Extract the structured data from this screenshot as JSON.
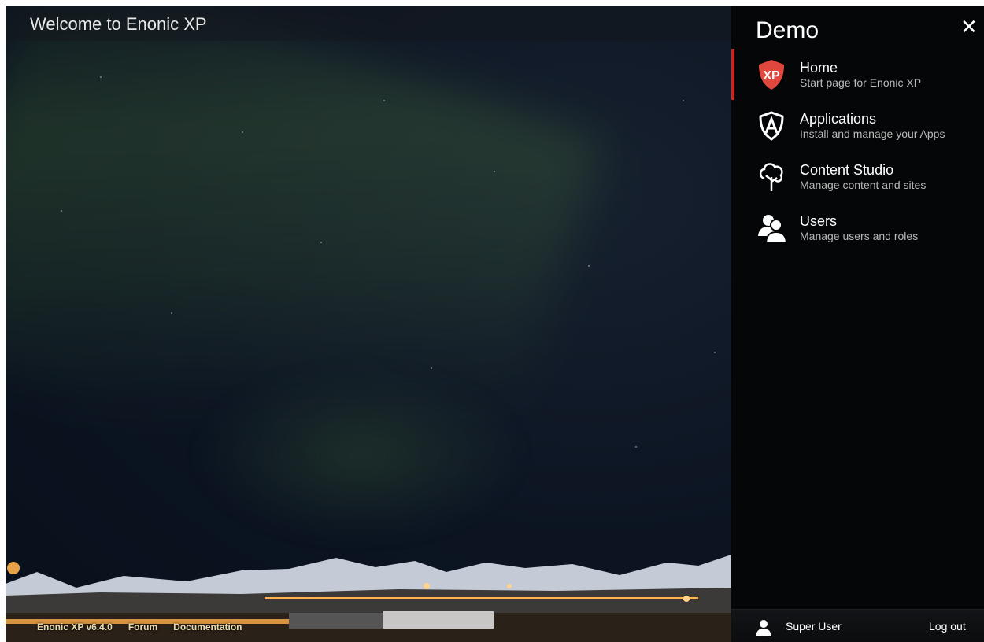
{
  "header": {
    "title": "Welcome to Enonic XP"
  },
  "footer": {
    "links": [
      "Enonic XP v6.4.0",
      "Forum",
      "Documentation"
    ]
  },
  "launcher": {
    "title": "Demo",
    "close_icon": "close-icon",
    "items": [
      {
        "name": "Home",
        "description": "Start page for Enonic XP",
        "icon": "xp-logo-icon",
        "active": true
      },
      {
        "name": "Applications",
        "description": "Install and manage your Apps",
        "icon": "applications-icon",
        "active": false
      },
      {
        "name": "Content Studio",
        "description": "Manage content and sites",
        "icon": "content-studio-tree-icon",
        "active": false
      },
      {
        "name": "Users",
        "description": "Manage users and roles",
        "icon": "users-icon",
        "active": false
      }
    ],
    "user": {
      "name": "Super User",
      "logout_label": "Log out",
      "icon": "user-icon"
    }
  },
  "colors": {
    "accent": "#d0231d",
    "panel_bg": "#050608",
    "xp_logo_red": "#e1483d"
  }
}
